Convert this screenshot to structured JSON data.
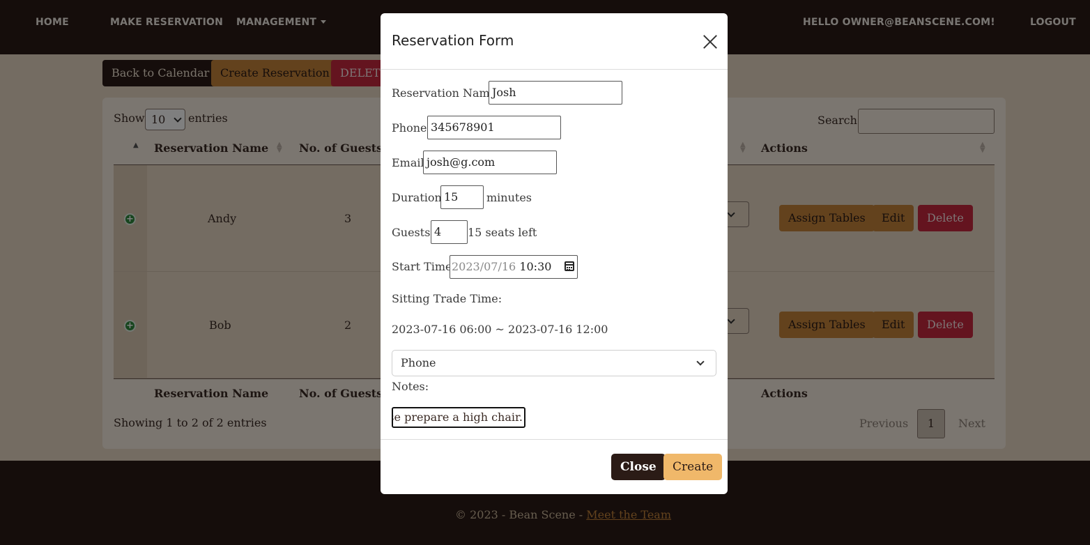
{
  "nav": {
    "home": "HOME",
    "make_reservation": "MAKE RESERVATION",
    "management": "MANAGEMENT",
    "greeting": "HELLO OWNER@BEANSCENE.COM!",
    "logout": "LOGOUT"
  },
  "toolbar": {
    "back": "Back to Calendar",
    "create": "Create Reservation",
    "delete": "DELETE"
  },
  "table": {
    "show_label": "Show",
    "entries_value": "10",
    "entries_label": "entries",
    "search_label": "Search:",
    "columns": [
      "Reservation Name",
      "No. of Guests",
      "Actions"
    ],
    "rows": [
      {
        "name": "Andy",
        "guests": "3",
        "assign": "Assign Tables",
        "edit": "Edit",
        "delete": "Delete"
      },
      {
        "name": "Bob",
        "guests": "2",
        "assign": "Assign Tables",
        "edit": "Edit",
        "delete": "Delete"
      }
    ],
    "info": "Showing 1 to 2 of 2 entries",
    "pagination": {
      "previous": "Previous",
      "current": "1",
      "next": "Next"
    }
  },
  "modal": {
    "title": "Reservation Form",
    "name_label": "Reservation Name:",
    "name_value": "Josh",
    "phone_label": "Phone:",
    "phone_value": "345678901",
    "email_label": "Email:",
    "email_value": "josh@g.com",
    "duration_label": "Duration:",
    "duration_value": "15",
    "duration_unit": "minutes",
    "guests_label": "Guests:",
    "guests_value": "4",
    "seats_left": "15 seats left",
    "start_label": "Start Time:",
    "start_date": "2023/07/16",
    "start_time": "10:30",
    "sitting_label": "Sitting Trade Time:",
    "sitting_value": "2023-07-16 06:00 ~ 2023-07-16 12:00",
    "source_value": "Phone",
    "notes_label": "Notes:",
    "notes_value": "ase prepare a high chair.",
    "close_button": "Close",
    "create_button": "Create"
  },
  "footer": {
    "copyright": "© 2023 - Bean Scene - ",
    "team_link": "Meet the Team"
  },
  "colors": {
    "brand_dark": "#2b1b16",
    "accent_tan": "#c6853b",
    "danger_red": "#c8283f",
    "page_bg": "#e9d9c5",
    "create_button": "#f0b86a"
  }
}
